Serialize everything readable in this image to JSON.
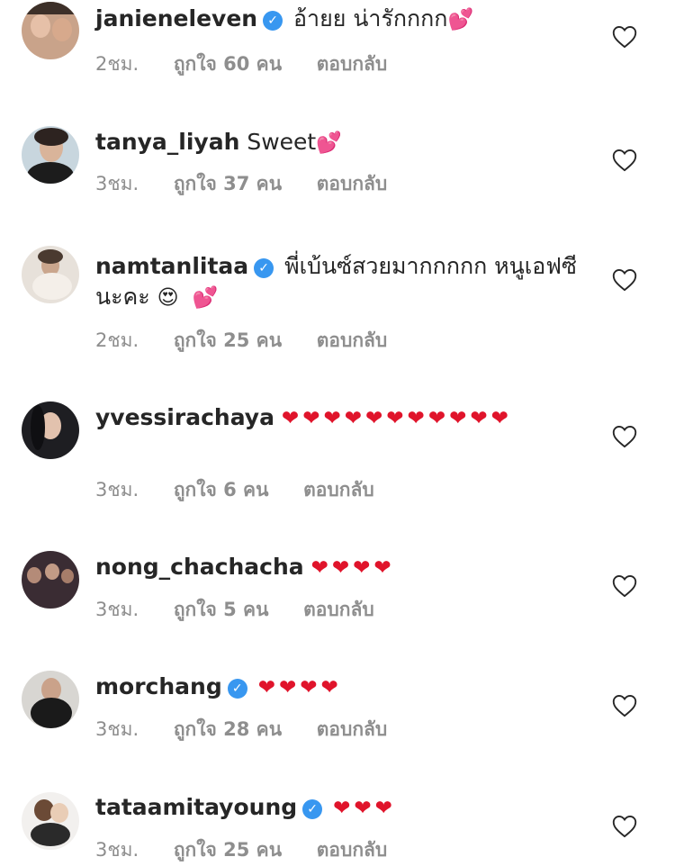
{
  "comments": [
    {
      "username": "janieneleven",
      "verified": true,
      "text": "อ้ายย น่ารักกกก",
      "emoji": "💕",
      "time": "2ชม.",
      "likes": "ถูกใจ 60 คน",
      "reply": "ตอบกลับ"
    },
    {
      "username": "tanya_liyah",
      "verified": false,
      "text": "Sweet",
      "emoji": "💕",
      "time": "3ชม.",
      "likes": "ถูกใจ 37 คน",
      "reply": "ตอบกลับ"
    },
    {
      "username": "namtanlitaa",
      "verified": true,
      "text": "พี่เบ้นซ์สวยมากกกกก หนูเอฟซี นะคะ",
      "emoji": "😍 💕",
      "time": "2ชม.",
      "likes": "ถูกใจ 25 คน",
      "reply": "ตอบกลับ"
    },
    {
      "username": "yvessirachaya",
      "verified": false,
      "text": "",
      "emoji": "❤❤❤❤❤❤❤❤❤❤❤",
      "time": "3ชม.",
      "likes": "ถูกใจ 6 คน",
      "reply": "ตอบกลับ"
    },
    {
      "username": "nong_chachacha",
      "verified": false,
      "text": "",
      "emoji": "❤❤❤❤",
      "time": "3ชม.",
      "likes": "ถูกใจ 5 คน",
      "reply": "ตอบกลับ"
    },
    {
      "username": "morchang",
      "verified": true,
      "text": "",
      "emoji": "❤❤❤❤",
      "time": "3ชม.",
      "likes": "ถูกใจ 28 คน",
      "reply": "ตอบกลับ"
    },
    {
      "username": "tataamitayoung",
      "verified": true,
      "text": "",
      "emoji": "❤❤❤",
      "time": "3ชม.",
      "likes": "ถูกใจ 25 คน",
      "reply": "ตอบกลับ"
    }
  ],
  "icons": {
    "verified": "verified-badge-icon",
    "like": "heart-outline-icon"
  },
  "colors": {
    "text": "#262626",
    "meta": "#8e8e8e",
    "verified": "#3897f0",
    "heart_red": "#e0142b",
    "heart_pink": "#ec4ca8"
  }
}
